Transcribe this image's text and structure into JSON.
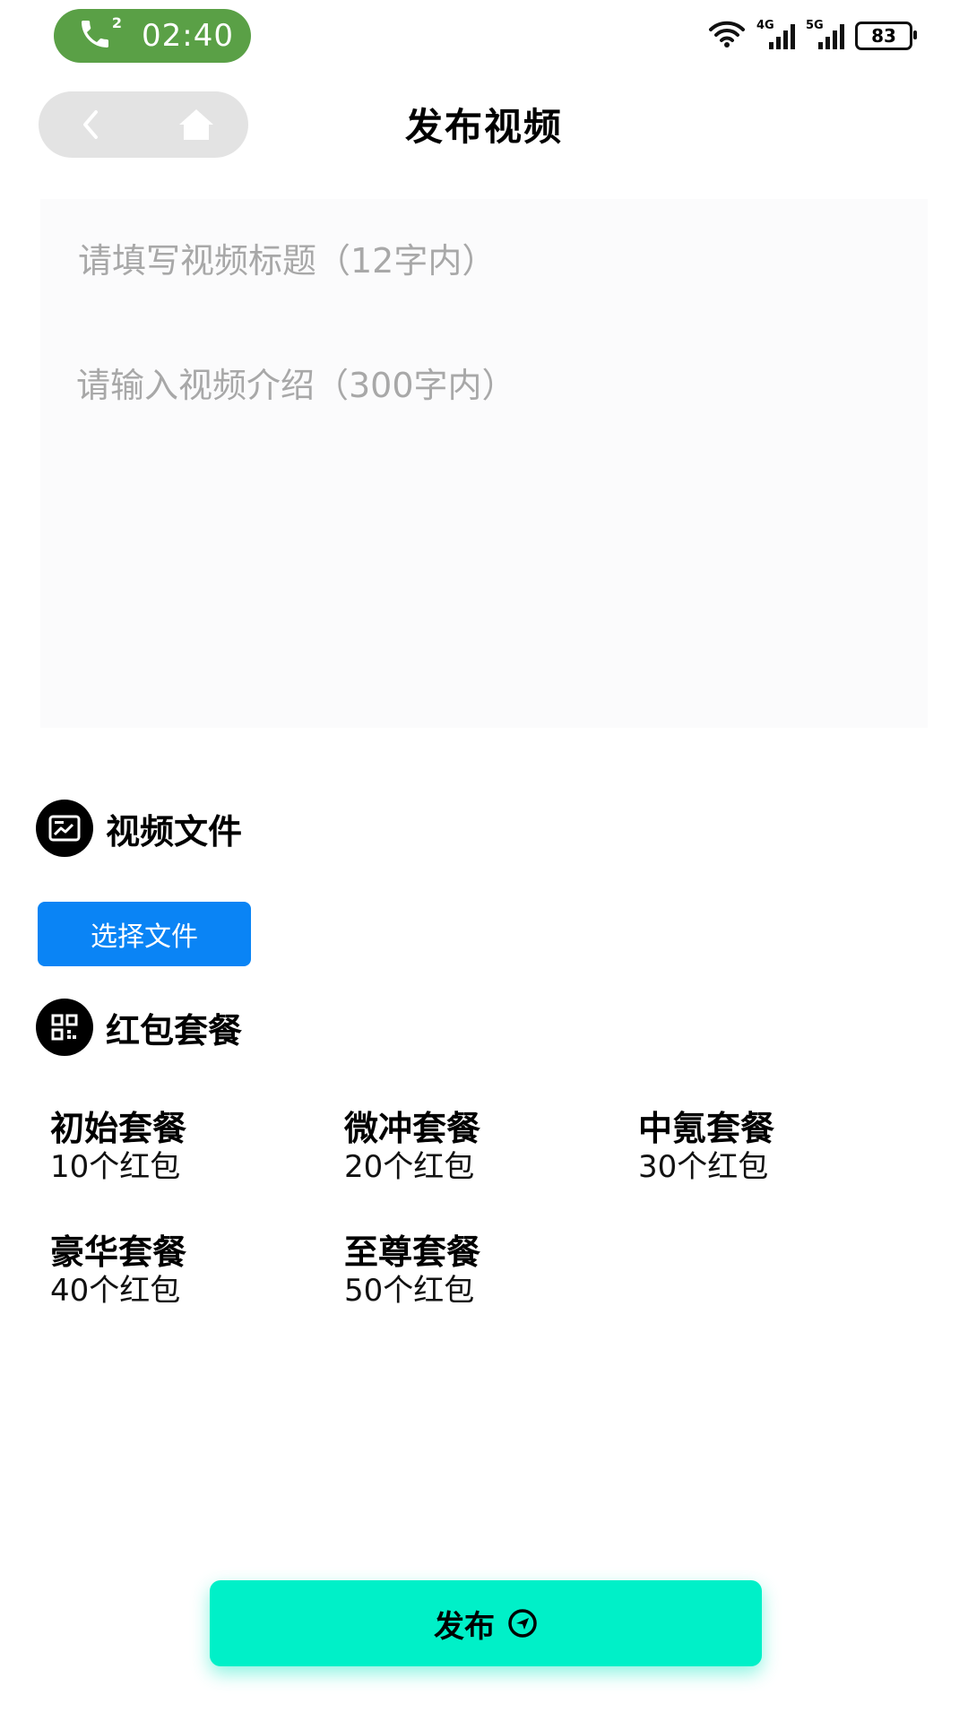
{
  "status_bar": {
    "call_count": "2",
    "time": "02:40",
    "network_1": "4G",
    "network_2": "5G",
    "battery": "83"
  },
  "header": {
    "title": "发布视频"
  },
  "form": {
    "title_placeholder": "请填写视频标题（12字内）",
    "intro_placeholder": "请输入视频介绍（300字内）"
  },
  "video_section": {
    "heading": "视频文件",
    "icon": "image-icon",
    "choose_label": "选择文件"
  },
  "package_section": {
    "heading": "红包套餐",
    "icon": "qr-code-icon",
    "packages": [
      {
        "name": "初始套餐",
        "count": "10个红包"
      },
      {
        "name": "微冲套餐",
        "count": "20个红包"
      },
      {
        "name": "中氪套餐",
        "count": "30个红包"
      },
      {
        "name": "豪华套餐",
        "count": "40个红包"
      },
      {
        "name": "至尊套餐",
        "count": "50个红包"
      }
    ]
  },
  "publish": {
    "label": "发布",
    "icon": "send-icon"
  },
  "colors": {
    "call_pill": "#5aa046",
    "choose_button": "#0a84f5",
    "publish_button": "#00f0c8"
  }
}
